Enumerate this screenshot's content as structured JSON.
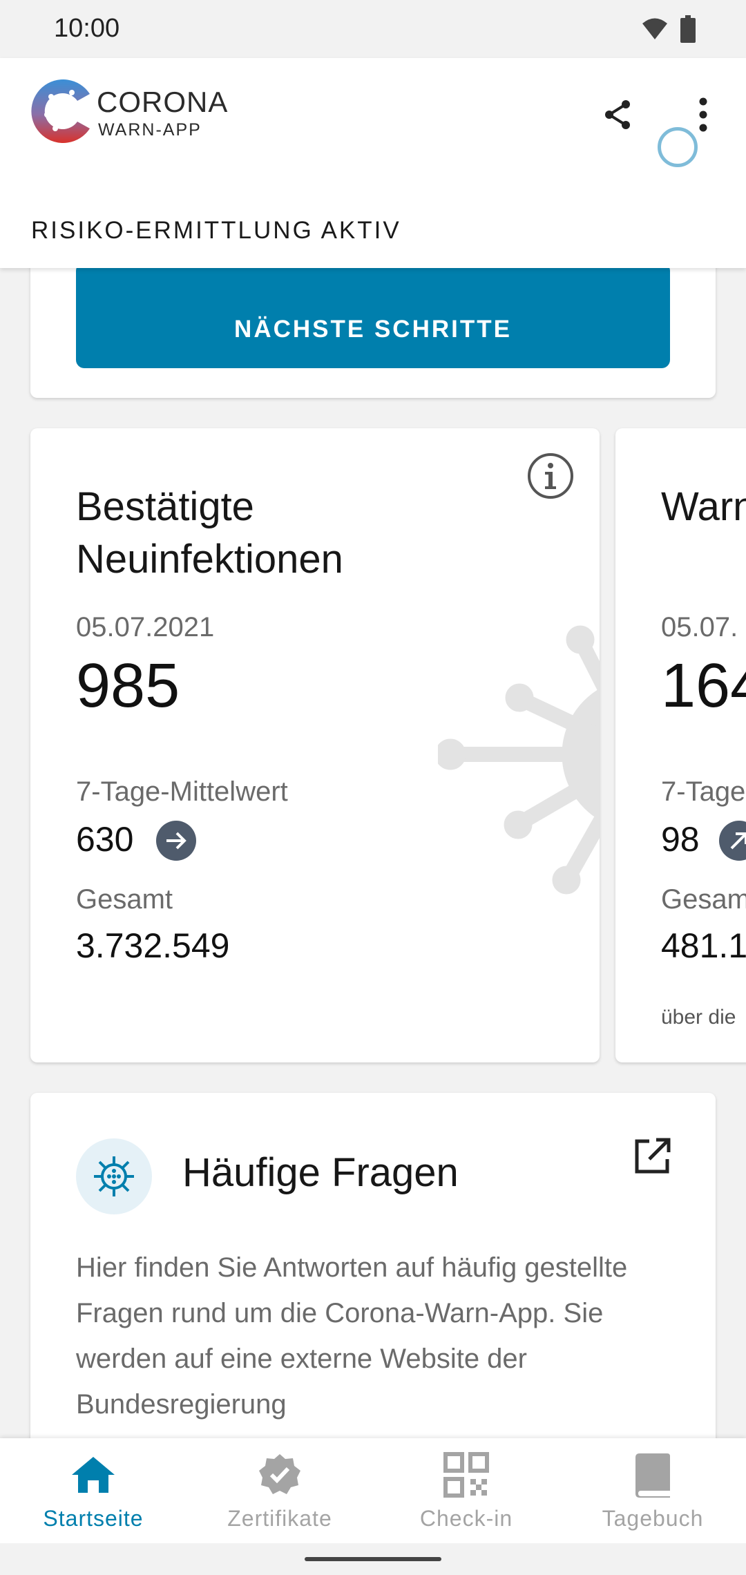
{
  "status_bar": {
    "time": "10:00",
    "icons": [
      "wifi-icon",
      "battery-icon"
    ]
  },
  "header": {
    "logo_title": "CORONA",
    "logo_subtitle": "WARN-APP",
    "actions": [
      "share-icon",
      "more-vert-icon"
    ],
    "risk_status": "RISIKO-ERMITTLUNG AKTIV"
  },
  "next_steps": {
    "button_label": "NÄCHSTE SCHRITTE"
  },
  "statistics": [
    {
      "title": "Bestätigte Neuinfektionen",
      "date": "05.07.2021",
      "value": "985",
      "avg_label": "7-Tage-Mittelwert",
      "avg_value": "630",
      "trend": "stable",
      "total_label": "Gesamt",
      "total_value": "3.732.549"
    },
    {
      "title": "Warn",
      "date": "05.07.",
      "value": "164",
      "avg_label": "7-Tage",
      "avg_value": "98",
      "trend": "increasing",
      "total_label": "Gesam",
      "total_value": "481.1",
      "footnote": "über die"
    }
  ],
  "faq": {
    "title": "Häufige Fragen",
    "text": "Hier finden Sie Antworten auf häufig gestellte Fragen rund um die Corona-Warn-App. Sie werden auf eine externe Website der Bundesregierung"
  },
  "bottom_nav": [
    {
      "label": "Startseite",
      "icon": "home-icon",
      "active": true
    },
    {
      "label": "Zertifikate",
      "icon": "verified-badge-icon",
      "active": false
    },
    {
      "label": "Check-in",
      "icon": "qr-code-icon",
      "active": false
    },
    {
      "label": "Tagebuch",
      "icon": "book-icon",
      "active": false
    }
  ],
  "colors": {
    "accent": "#007fad",
    "spinner": "#7fbcd9",
    "trend_badge": "#4f5b6c",
    "inactive_nav": "#a4a4a4"
  }
}
